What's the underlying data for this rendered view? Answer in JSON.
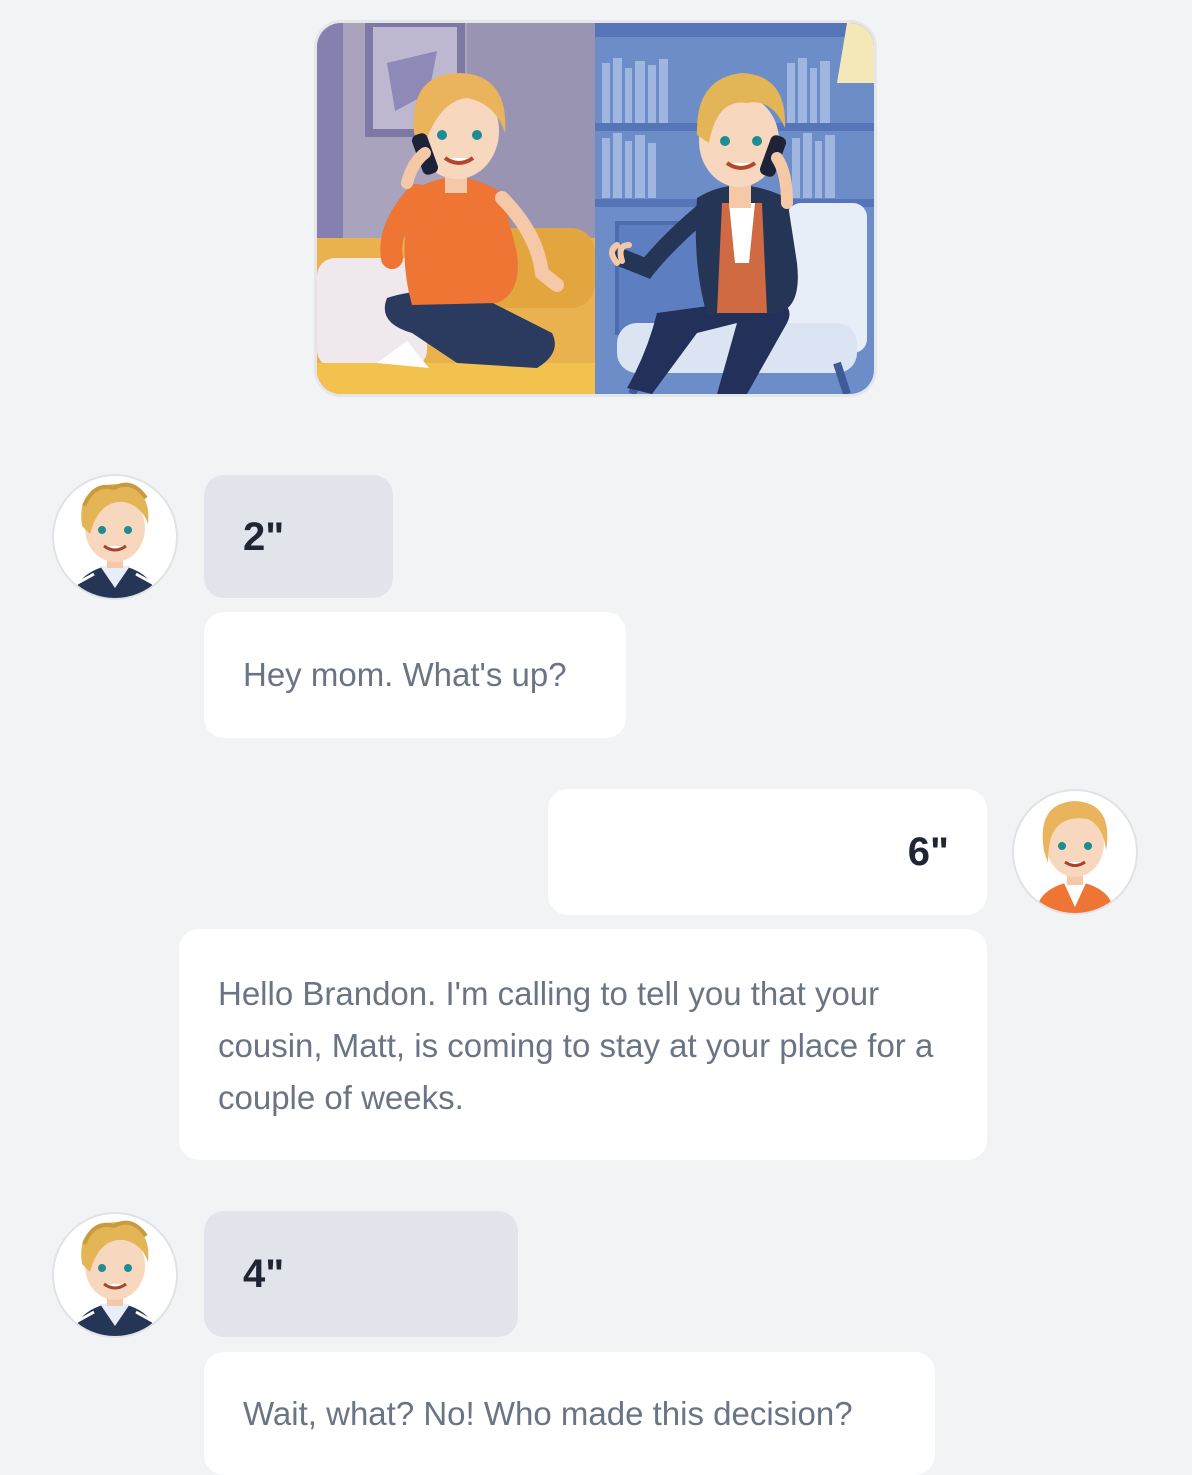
{
  "scene": {
    "icon": "phone-call-illustration",
    "colors": {
      "left_wall": "#a9a3bd",
      "right_wall": "#6d8dc9",
      "sofa": "#e9b24f",
      "mom_shirt": "#ee7534",
      "pants": "#2b3a5f"
    }
  },
  "messages": [
    {
      "speaker": "brandon",
      "side": "left",
      "duration": "2\"",
      "text": "Hey mom. What's up?"
    },
    {
      "speaker": "mom",
      "side": "right",
      "duration": "6\"",
      "text": "Hello Brandon. I'm calling to tell you that your cousin, Matt, is coming to stay at your place for a couple of weeks."
    },
    {
      "speaker": "brandon",
      "side": "left",
      "duration": "4\"",
      "text": "Wait, what? No! Who made this decision?"
    }
  ],
  "avatars": {
    "brandon": {
      "icon": "brandon-avatar-icon",
      "jacket": "#253556",
      "stripe": "#ffffff"
    },
    "mom": {
      "icon": "mom-avatar-icon",
      "shirt": "#ee7534"
    }
  }
}
